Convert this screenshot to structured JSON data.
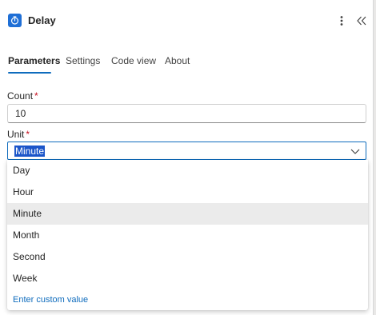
{
  "header": {
    "title": "Delay",
    "icon": "timer-icon",
    "more_icon": "more-vertical-icon",
    "collapse_icon": "double-chevron-left-icon"
  },
  "tabs": [
    {
      "label": "Parameters",
      "active": true
    },
    {
      "label": "Settings",
      "active": false
    },
    {
      "label": "Code view",
      "active": false
    },
    {
      "label": "About",
      "active": false
    }
  ],
  "count": {
    "label": "Count",
    "required_mark": "*",
    "value": "10"
  },
  "unit": {
    "label": "Unit",
    "required_mark": "*",
    "value": "Minute",
    "options": [
      "Day",
      "Hour",
      "Minute",
      "Month",
      "Second",
      "Week"
    ],
    "custom_option": "Enter custom value"
  },
  "colors": {
    "accent": "#0f6cbd",
    "icon_bg": "#1f6fd6",
    "selection_highlight": "#1b55c9",
    "required": "#c50f1f",
    "selected_option_bg": "#ebebeb"
  }
}
